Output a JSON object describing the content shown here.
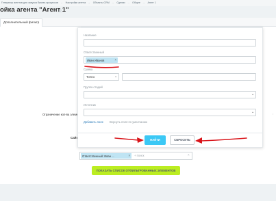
{
  "breadcrumb": {
    "items": [
      "Генератор агентов для запуска бизнес-процессов",
      "Настройки агента",
      "Объекты CRM",
      "Сделки",
      "Общее",
      "Агент 1"
    ],
    "separator": "→"
  },
  "page": {
    "title": "ойка агента \"Агент 1\"",
    "star_glyph": "☆"
  },
  "tabs": [
    {
      "label": "Дополнительный фильтр"
    }
  ],
  "form": {
    "limit_label": "Ограничение кол-ва элементов за од",
    "site_label": "Сайт",
    "ellipsis_right": ":"
  },
  "filter_popup": {
    "name_label": "Название",
    "name_value": "",
    "responsible_label": "Ответственный",
    "responsible_tag": "Иван Иванов",
    "tag_remove": "×",
    "amount_label": "Сумма",
    "amount_mode": "Точно",
    "amount_value": "",
    "stage_group_label": "Группа стадий",
    "stage_group_value": "",
    "source_label": "Источник",
    "source_value": "",
    "add_field_link": "Добавить поле",
    "reset_fields_link": "Вернуть поля по умолчанию",
    "find_button": "НАЙТИ",
    "reset_button": "СБРОСИТЬ"
  },
  "filter_bar": {
    "chip_label": "Ответственный: Иван ...",
    "chip_remove": "×",
    "search_placeholder": "+ поиск",
    "clear_glyph": "×"
  },
  "actions": {
    "show_list_button": "ПОКАЗАТЬ СПИСОК ОТФИЛЬТРОВАННЫХ ЭЛЕМЕНТОВ"
  },
  "icons": {
    "chevron": "chevron-down-icon",
    "star": "star-icon",
    "close": "close-icon"
  },
  "colors": {
    "accent_blue": "#3bc8f5",
    "accent_green": "#bbed21",
    "tag_blue": "#bfe4f3",
    "annotation_red": "#d9141a"
  }
}
